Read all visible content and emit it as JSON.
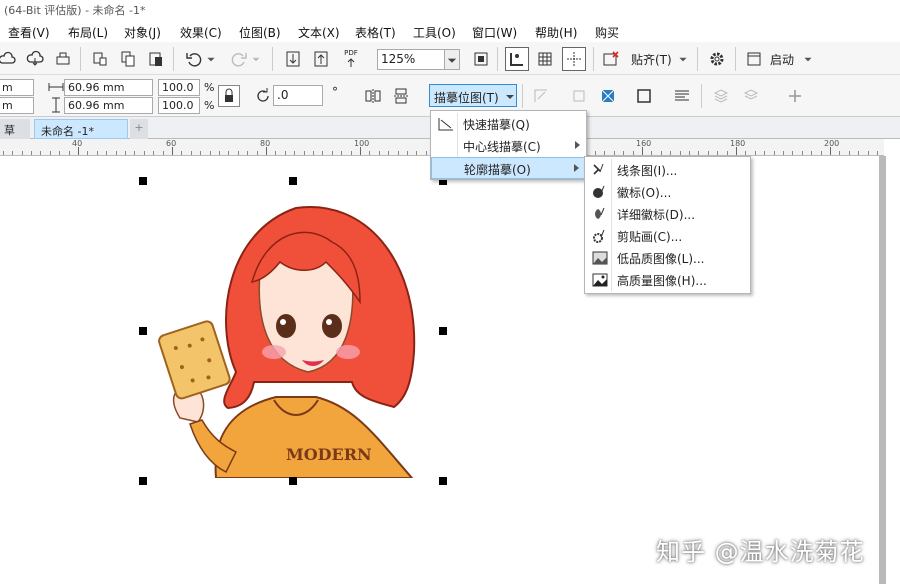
{
  "window": {
    "title": "(64-Bit 评估版) - 未命名 -1*"
  },
  "menubar": {
    "items": [
      "查看(V)",
      "布局(L)",
      "对象(J)",
      "效果(C)",
      "位图(B)",
      "文本(X)",
      "表格(T)",
      "工具(O)",
      "窗口(W)",
      "帮助(H)",
      "购买"
    ]
  },
  "toolbar": {
    "zoom": "125%",
    "snap_label": "贴齐(T)",
    "launch_label": "启动",
    "pdf_label": "PDF"
  },
  "propbar": {
    "x": "m",
    "y": "m",
    "width": "60.96 mm",
    "height": "60.96 mm",
    "scale_w": "100.0",
    "scale_h": "100.0",
    "pct_w": "%",
    "pct_h": "%",
    "rotation": ".0",
    "degree": "°",
    "trace_button": "描摹位图(T)"
  },
  "tabs": {
    "left": "草",
    "active": "未命名 -1*",
    "add": "+"
  },
  "ruler": {
    "labels": [
      "40",
      "60",
      "80",
      "100",
      "120",
      "140",
      "160",
      "180",
      "200"
    ]
  },
  "trace_menu": {
    "items": [
      "快速描摹(Q)",
      "中心线描摹(C)",
      "轮廓描摹(O)"
    ]
  },
  "outline_submenu": {
    "items": [
      "线条图(I)...",
      "徽标(O)...",
      "详细徽标(D)...",
      "剪贴画(C)...",
      "低品质图像(L)...",
      "高质量图像(H)..."
    ]
  },
  "artwork": {
    "shirt_text": "MODERN"
  },
  "watermark": "知乎 @温水洗菊花",
  "colors": {
    "highlight": "#cce8ff",
    "hair": "#f0503a",
    "hoodie": "#f2a53c"
  }
}
